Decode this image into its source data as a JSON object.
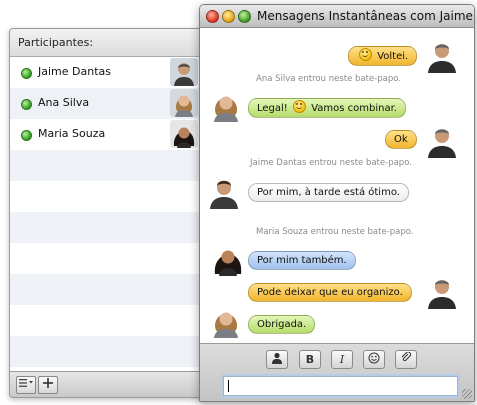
{
  "window": {
    "title": "Mensagens Instantâneas com Jaime"
  },
  "drawer": {
    "header": "Participantes:",
    "participants": [
      {
        "name": "Jaime Dantas",
        "status": "online"
      },
      {
        "name": "Ana Silva",
        "status": "online"
      },
      {
        "name": "Maria Souza",
        "status": "online"
      }
    ],
    "footer_buttons": [
      "list-options",
      "add"
    ]
  },
  "conversation": {
    "m1": "Voltei.",
    "n1": "Ana Silva entrou neste bate-papo.",
    "m2a": "Legal!",
    "m2b": "Vamos combinar.",
    "m3": "Ok",
    "n2": "Jaime Dantas entrou neste bate-papo.",
    "m4": "Por mim, à tarde está ótimo.",
    "n3": "Maria Souza entrou neste bate-papo.",
    "m5": "Por mim também.",
    "m6": "Pode deixar que eu organizo.",
    "m7": "Obrigada."
  },
  "toolbar": {
    "bold": "B",
    "italic": "I",
    "buttons": [
      "person-icon",
      "bold",
      "italic",
      "smiley-icon",
      "attach-icon"
    ]
  },
  "input": {
    "value": ""
  },
  "colors": {
    "orange": "#f2b52c",
    "green": "#b5dc6a",
    "blue": "#9fc1ee",
    "online": "#2f9a20"
  }
}
